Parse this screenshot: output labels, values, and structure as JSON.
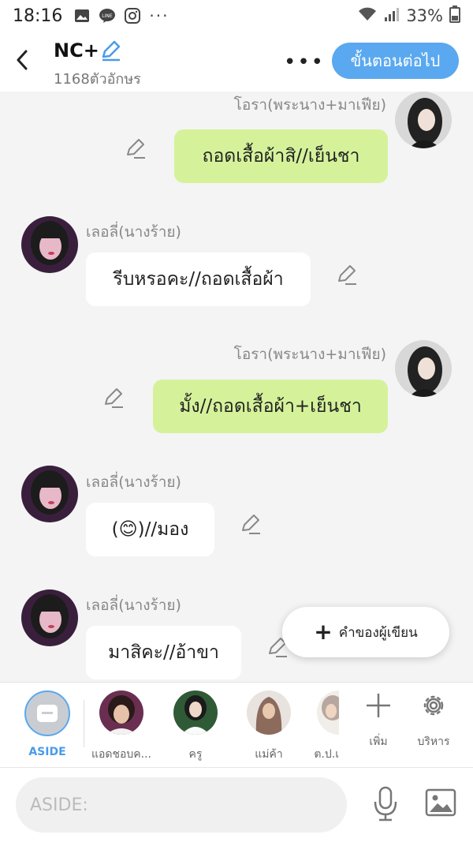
{
  "status_bar": {
    "time": "18:16",
    "battery": "33%",
    "more": "···"
  },
  "header": {
    "title": "NC+",
    "subtitle": "1168ตัวอักษร",
    "more": "•••",
    "next_button": "ขั้นตอนต่อไป"
  },
  "messages": [
    {
      "side": "right",
      "sender": "โอรา(พระนาง+มาเฟีย)",
      "text": "ถอดเสื้อผ้าสิ//เย็นชา"
    },
    {
      "side": "left",
      "sender": "เลอลี่(นางร้าย)",
      "text": "รีบหรอคะ//ถอดเสื้อผ้า"
    },
    {
      "side": "right",
      "sender": "โอรา(พระนาง+มาเฟีย)",
      "text": "มั้ง//ถอดเสื้อผ้า+เย็นชา"
    },
    {
      "side": "left",
      "sender": "เลอลี่(นางร้าย)",
      "text": "(😊)//มอง"
    },
    {
      "side": "left",
      "sender": "เลอลี่(นางร้าย)",
      "text": "มาสิคะ//อ้าขา"
    }
  ],
  "writer_note": {
    "label": "คำของผู้เขียน",
    "icon": "plus-icon"
  },
  "characters": {
    "aside_label": "ASIDE",
    "items": [
      {
        "label": "แอดชอบค..."
      },
      {
        "label": "ครู"
      },
      {
        "label": "แม่ค้า"
      },
      {
        "label": "ต.ป.เ"
      }
    ],
    "add_label": "เพิ่ม",
    "manage_label": "บริหาร"
  },
  "input": {
    "placeholder": "ASIDE:"
  },
  "colors": {
    "accent": "#5aa8ef",
    "my_bubble": "#d5f29b",
    "their_bubble": "#ffffff",
    "background": "#f4f4f4"
  }
}
